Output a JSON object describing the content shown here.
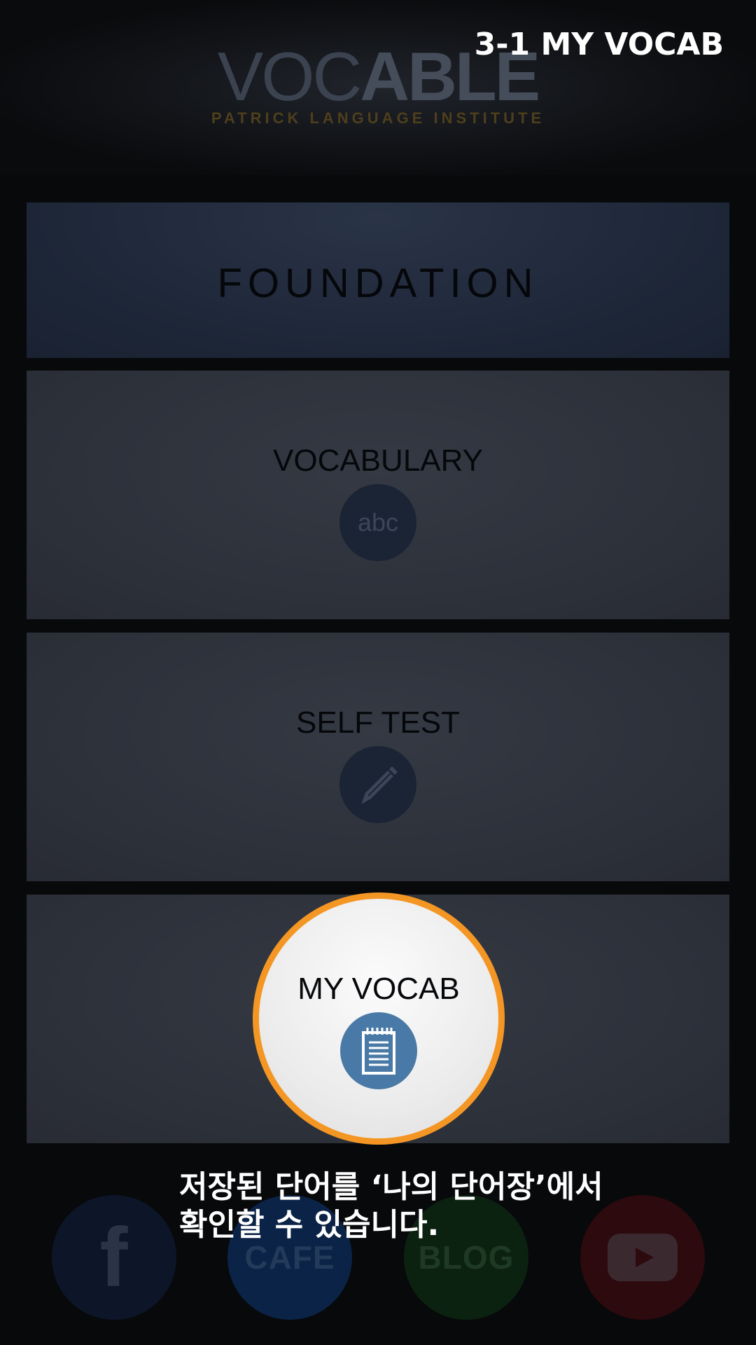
{
  "step_title": "3-1 MY VOCAB",
  "logo": {
    "text_light": "VOC",
    "text_bold": "ABLE",
    "subtitle": "PATRICK LANGUAGE INSTITUTE"
  },
  "level": {
    "label": "FOUNDATION"
  },
  "menu": [
    {
      "label": "VOCABULARY",
      "icon": "abc-icon",
      "icon_text": "abc"
    },
    {
      "label": "SELF TEST",
      "icon": "pencil-icon"
    },
    {
      "label": "MY VOCAB",
      "icon": "notepad-icon",
      "highlighted": true
    }
  ],
  "highlight_color": "#f49624",
  "caption": {
    "line1": "저장된 단어를 ‘나의 단어장’에서",
    "line2": "확인할 수 있습니다."
  },
  "social": [
    {
      "name": "facebook",
      "icon": "facebook-icon",
      "text": "f"
    },
    {
      "name": "cafe",
      "icon": "cafe-icon",
      "text": "CAFE"
    },
    {
      "name": "blog",
      "icon": "blog-icon",
      "text": "BLOG"
    },
    {
      "name": "youtube",
      "icon": "youtube-icon"
    }
  ]
}
